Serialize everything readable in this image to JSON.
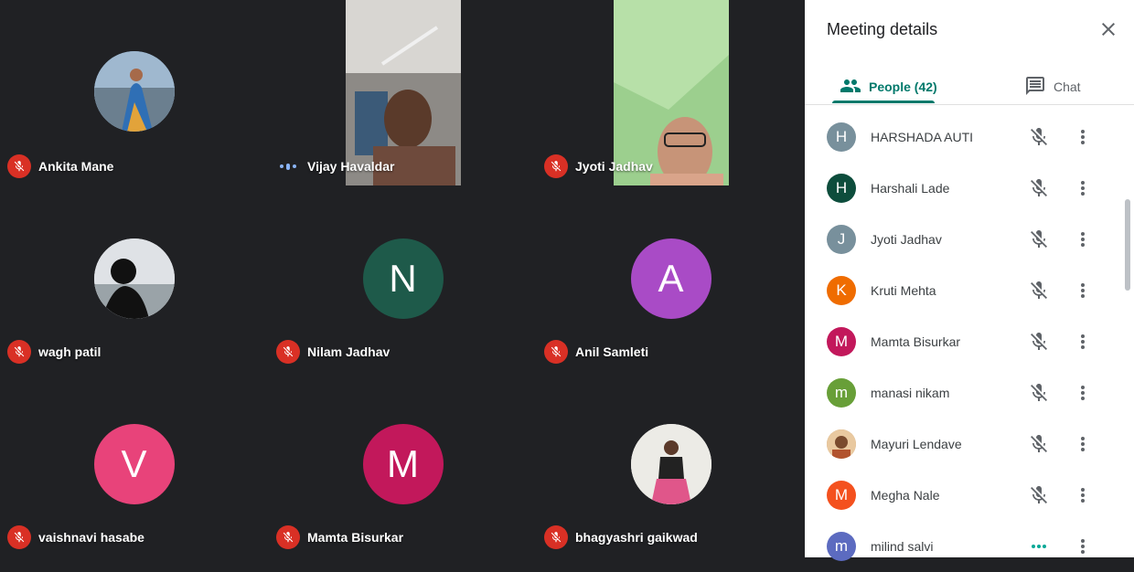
{
  "colors": {
    "mic_off_red": "#d93025",
    "accent_teal": "#00796b",
    "stage_bg": "#202124"
  },
  "tiles": [
    {
      "name": "Ankita Mane",
      "status": "muted",
      "avatar": "photo"
    },
    {
      "name": "Vijay Havaldar",
      "status": "speaking",
      "avatar": "video"
    },
    {
      "name": "Jyoti Jadhav",
      "status": "muted",
      "avatar": "video"
    },
    {
      "name": "wagh patil",
      "status": "muted",
      "avatar": "photo"
    },
    {
      "name": "Nilam Jadhav",
      "status": "muted",
      "initial": "N",
      "color": "#1e5a4a"
    },
    {
      "name": "Anil Samleti",
      "status": "muted",
      "initial": "A",
      "color": "#a94bc6"
    },
    {
      "name": "vaishnavi hasabe",
      "status": "muted",
      "initial": "V",
      "color": "#e8437a"
    },
    {
      "name": "Mamta Bisurkar",
      "status": "muted",
      "initial": "M",
      "color": "#c2185b"
    },
    {
      "name": "bhagyashri gaikwad",
      "status": "muted",
      "avatar": "photo"
    }
  ],
  "panel": {
    "title": "Meeting details",
    "close_icon": "close-icon",
    "tabs": [
      {
        "label": "People (42)",
        "icon": "people-icon",
        "active": true
      },
      {
        "label": "Chat",
        "icon": "chat-icon",
        "active": false
      }
    ],
    "people": [
      {
        "name": "HARSHADA AUTI",
        "initial": "H",
        "color": "#78909c",
        "mic": "muted"
      },
      {
        "name": "Harshali Lade",
        "initial": "H",
        "color": "#0d4d3c",
        "mic": "muted"
      },
      {
        "name": "Jyoti Jadhav",
        "initial": "J",
        "color": "#78909c",
        "mic": "muted"
      },
      {
        "name": "Kruti Mehta",
        "initial": "K",
        "color": "#ef6c00",
        "mic": "muted"
      },
      {
        "name": "Mamta Bisurkar",
        "initial": "M",
        "color": "#c2185b",
        "mic": "muted"
      },
      {
        "name": "manasi nikam",
        "initial": "m",
        "color": "#689f38",
        "mic": "muted"
      },
      {
        "name": "Mayuri Lendave",
        "initial": "",
        "color": "#c49a6c",
        "mic": "muted"
      },
      {
        "name": "Megha Nale",
        "initial": "M",
        "color": "#f4511e",
        "mic": "muted"
      },
      {
        "name": "milind salvi",
        "initial": "m",
        "color": "#5c6bc0",
        "mic": "speaking"
      }
    ]
  }
}
